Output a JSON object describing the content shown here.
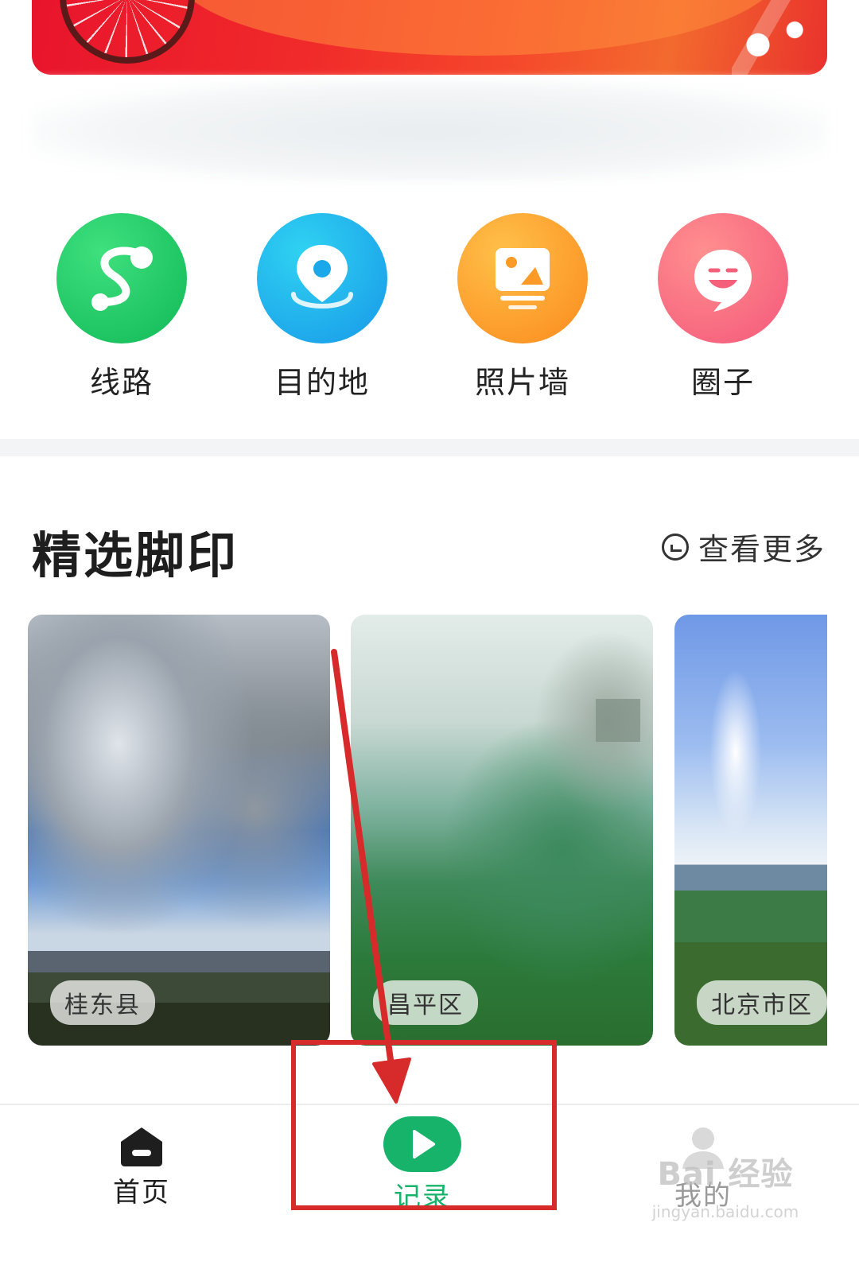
{
  "quick_actions": [
    {
      "label": "线路",
      "icon": "route-icon",
      "color": "#1fc866"
    },
    {
      "label": "目的地",
      "icon": "location-pin-icon",
      "color": "#1ab6e8"
    },
    {
      "label": "照片墙",
      "icon": "photo-wall-icon",
      "color": "#fb9a27"
    },
    {
      "label": "圈子",
      "icon": "chat-smile-icon",
      "color": "#f66a7d"
    }
  ],
  "section": {
    "title": "精选脚印",
    "see_more": "查看更多"
  },
  "cards": [
    {
      "location": "桂东县"
    },
    {
      "location": "昌平区"
    },
    {
      "location": "北京市区"
    }
  ],
  "bottom_nav": {
    "home": "首页",
    "record": "记录",
    "mine": "我的"
  },
  "watermark": {
    "text": "Bai 经验",
    "sub": "jingyan.baidu.com"
  },
  "colors": {
    "accent_green": "#17b36b",
    "annotation_red": "#d72a2a"
  }
}
